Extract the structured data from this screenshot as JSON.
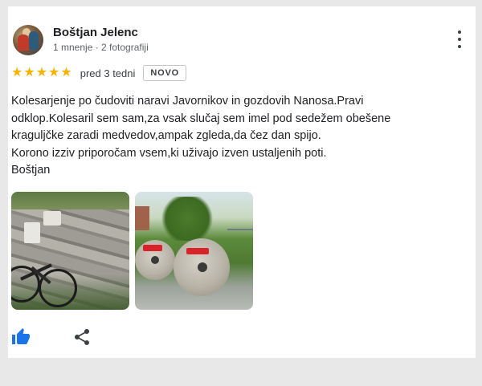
{
  "review": {
    "author_name": "Boštjan Jelenc",
    "author_meta": "1 mnenje · 2 fotografiji",
    "rating": 5,
    "rating_max": 5,
    "time_ago": "pred 3 tedni",
    "badge": "NOVO",
    "text_lines": [
      "Kolesarjenje po čudoviti naravi Javornikov in gozdovih Nanosa.Pravi",
      "odklop.Kolesaril sem sam,za vsak slučaj sem imel pod sedežem obešene",
      "kraguljčke zaradi medvedov,ampak zgleda,da čez dan spijo.",
      "Korono izziv priporočam vsem,ki uživajo izven ustaljenih poti.",
      "Boštjan"
    ]
  },
  "colors": {
    "star": "#f6b400",
    "like_active": "#1a73e8",
    "icon": "#3c4043"
  },
  "icons": {
    "more": "more-vert-icon",
    "like": "thumb-up-icon",
    "share": "share-icon"
  }
}
